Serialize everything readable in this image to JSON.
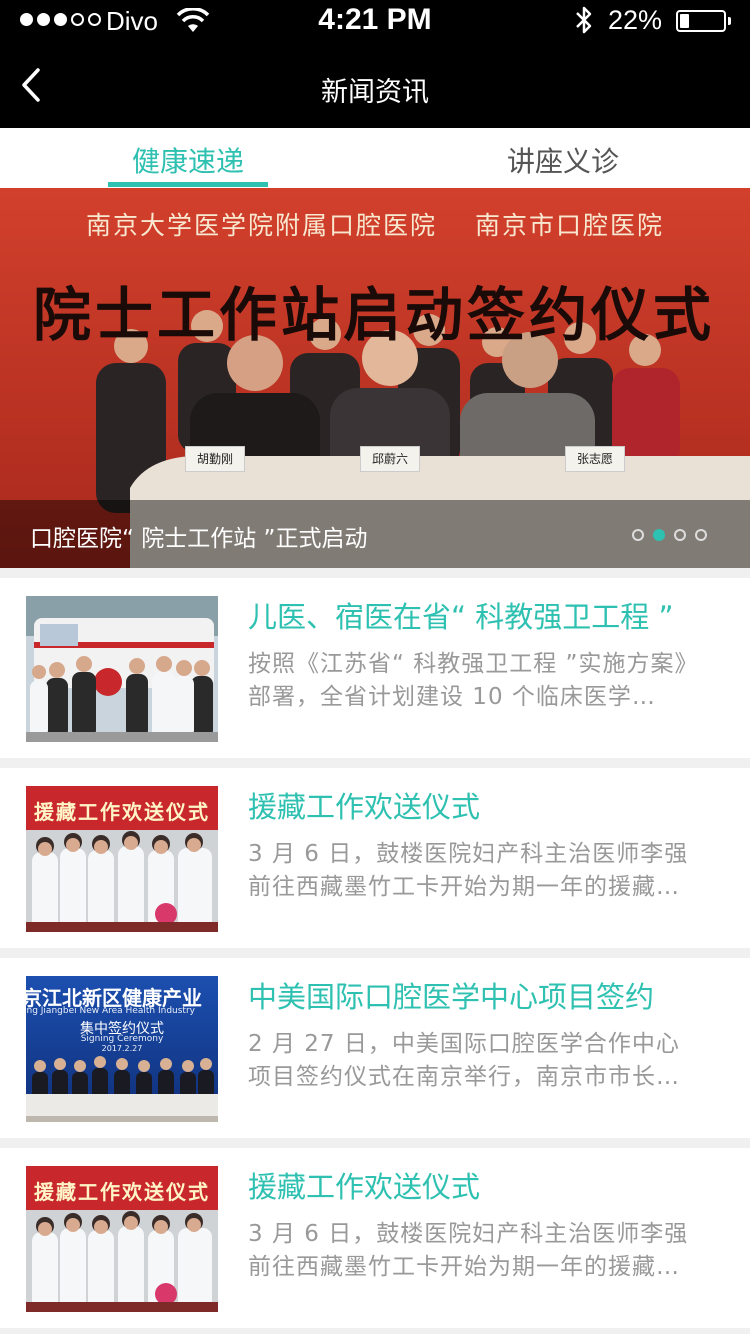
{
  "status_bar": {
    "carrier": "Divo",
    "time": "4:21 PM",
    "battery": "22%",
    "battery_level": 0.22
  },
  "nav": {
    "title": "新闻资讯"
  },
  "tabs": [
    {
      "label": "健康速递",
      "active": true
    },
    {
      "label": "讲座义诊",
      "active": false
    }
  ],
  "banner": {
    "caption": "口腔医院“ 院士工作站 ”正式启动",
    "pages": 4,
    "active_page": 2,
    "image_text": {
      "line1": "南京大学医学院附属口腔医院 南京市口腔医院",
      "line2": "院士工作站启动签约仪式",
      "nameplates": [
        "胡勤刚",
        "邱蔚六",
        "张志愿"
      ]
    }
  },
  "news": [
    {
      "title": "儿医、宿医在省“ 科教强卫工程 ”",
      "desc_line1": "按照《江苏省“ 科教强卫工程 ”实施方案》",
      "desc_line2": "部署，全省计划建设 10 个临床医学…",
      "thumb": "ambulance-group"
    },
    {
      "title": "援藏工作欢送仪式",
      "desc_line1": "3 月 6 日，鼓楼医院妇产科主治医师李强",
      "desc_line2": "前往西藏墨竹工卡开始为期一年的援藏…",
      "thumb": "farewell-group",
      "thumb_banner": "援藏工作欢送仪式"
    },
    {
      "title": "中美国际口腔医学中心项目签约",
      "desc_line1": "2 月 27 日，中美国际口腔医学合作中心",
      "desc_line2": "项目签约仪式在南京举行，南京市市长…",
      "thumb": "signing-ceremony",
      "thumb_line1": "京江北新区健康产业",
      "thumb_line2": "ing Jiangbei New Area Health Industry",
      "thumb_line3": "集中签约仪式",
      "thumb_line4": "Signing Ceremony",
      "thumb_line5": "2017.2.27"
    },
    {
      "title": "援藏工作欢送仪式",
      "desc_line1": "3 月 6 日，鼓楼医院妇产科主治医师李强",
      "desc_line2": "前往西藏墨竹工卡开始为期一年的援藏…",
      "thumb": "farewell-group",
      "thumb_banner": "援藏工作欢送仪式"
    }
  ]
}
